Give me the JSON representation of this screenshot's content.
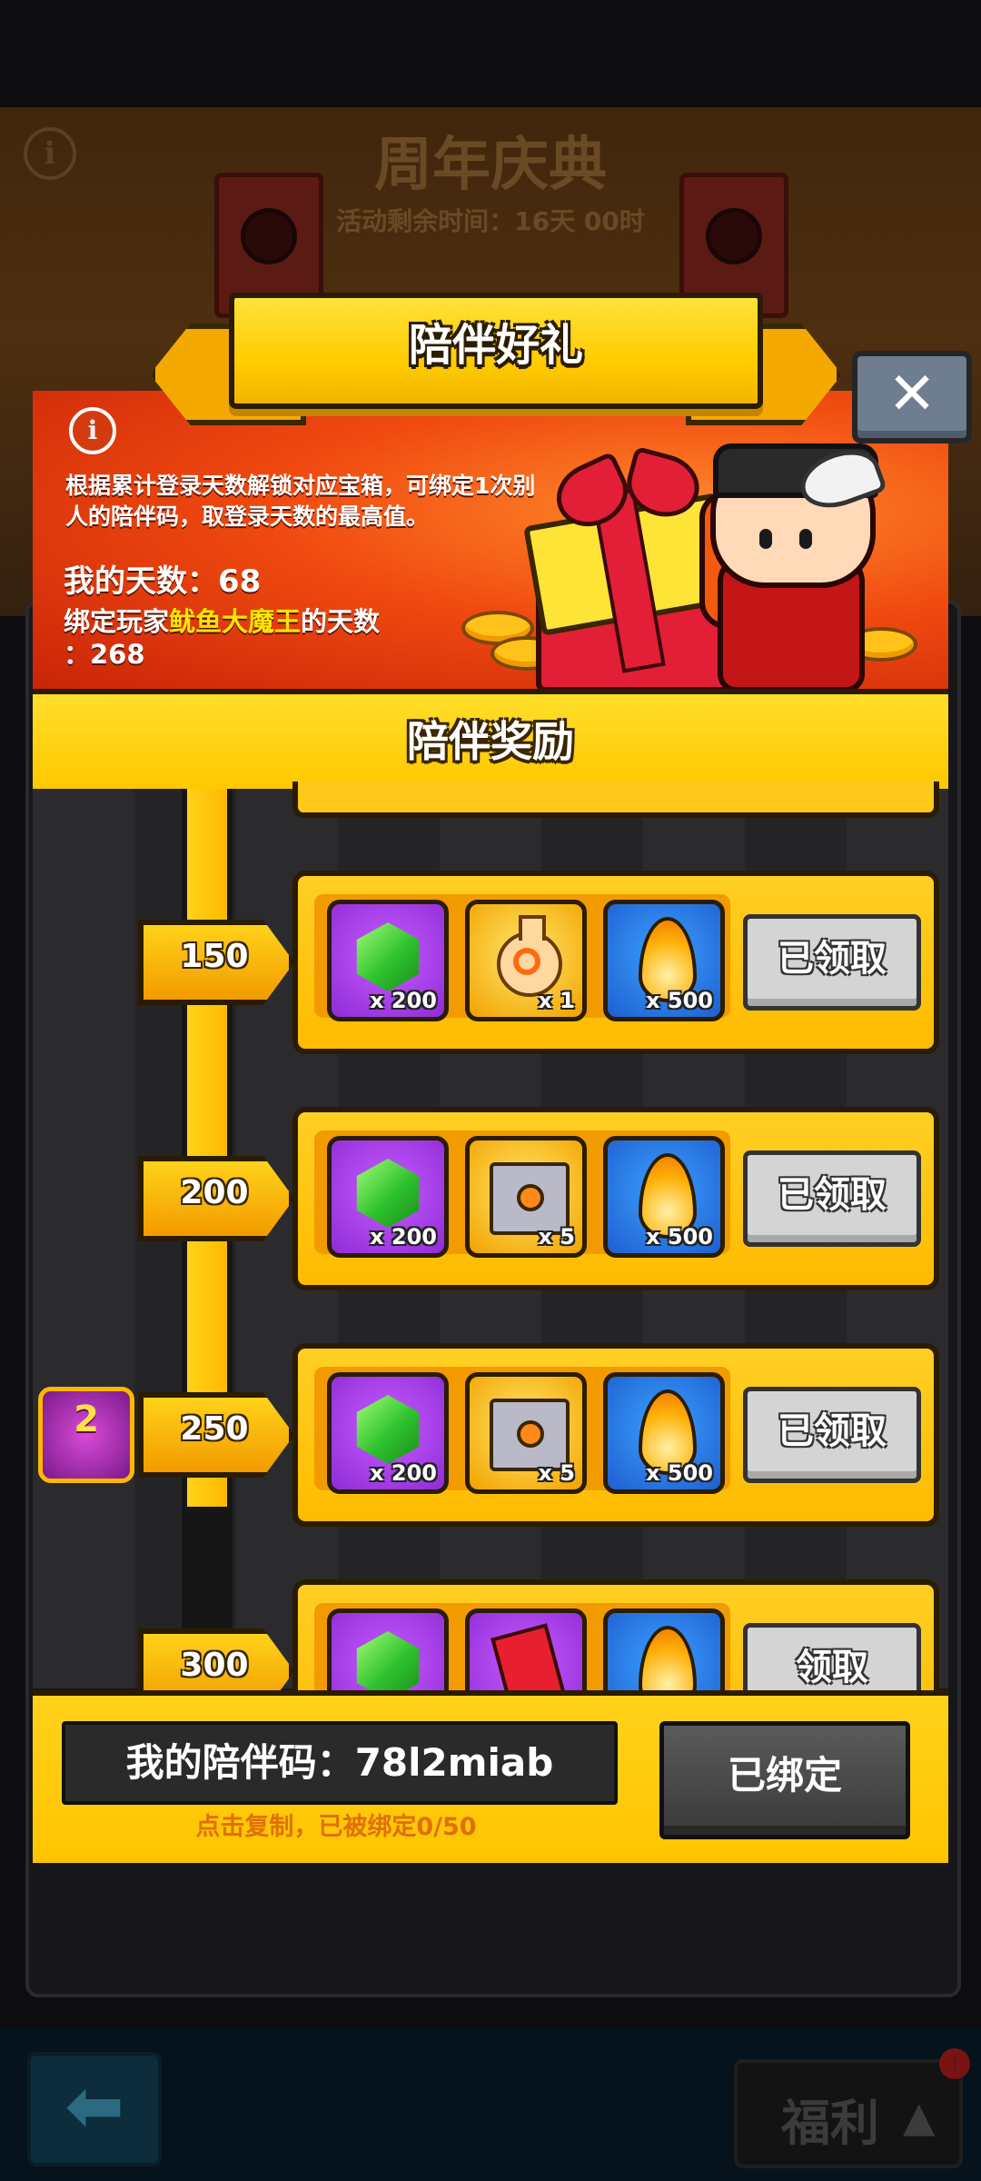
{
  "background": {
    "title": "周年庆典",
    "subtitle": "活动剩余时间：16天 00时"
  },
  "dialog": {
    "title": "陪伴好礼",
    "close_glyph": "✕",
    "info_glyph": "i",
    "description": "根据累计登录天数解锁对应宝箱，可绑定1次别人的陪伴码，取登录天数的最高值。",
    "my_days_label": "我的天数：",
    "my_days_value": "68",
    "bound_prefix": "绑定玩家",
    "bound_player_name": "鱿鱼大魔王",
    "bound_suffix": "的天数",
    "bound_days": "：268",
    "section_title": "陪伴奖励"
  },
  "tiers": [
    {
      "day": "150",
      "items": [
        {
          "icon": "green-gem-icon",
          "qty": "x 200"
        },
        {
          "icon": "potion-icon",
          "qty": "x 1"
        },
        {
          "icon": "flame-icon",
          "qty": "x 500"
        }
      ],
      "button": "已领取",
      "claimed": true
    },
    {
      "day": "200",
      "items": [
        {
          "icon": "green-gem-icon",
          "qty": "x 200"
        },
        {
          "icon": "chest-icon",
          "qty": "x 5"
        },
        {
          "icon": "flame-icon",
          "qty": "x 500"
        }
      ],
      "button": "已领取",
      "claimed": true
    },
    {
      "day": "250",
      "items": [
        {
          "icon": "green-gem-icon",
          "qty": "x 200"
        },
        {
          "icon": "chest-icon",
          "qty": "x 5"
        },
        {
          "icon": "flame-icon",
          "qty": "x 500"
        }
      ],
      "button": "已领取",
      "claimed": true
    },
    {
      "day": "300",
      "items": [
        {
          "icon": "green-gem-icon",
          "qty": ""
        },
        {
          "icon": "red-envelope-icon",
          "qty": ""
        },
        {
          "icon": "flame-icon",
          "qty": ""
        }
      ],
      "button": "领取",
      "claimed": false
    }
  ],
  "badge": {
    "icon": "anniversary-cake-icon",
    "number": "2"
  },
  "footer": {
    "code_label": "我的陪伴码：",
    "code_value": "78l2miab",
    "copy_hint": "点击复制，已被绑定0/50",
    "bound_button": "已绑定"
  },
  "bottom_nav": {
    "back_glyph": "⬅",
    "welfare_label": "福利",
    "welfare_glyph": "▲",
    "alert_glyph": "!"
  },
  "colors": {
    "accent_yellow": "#ffc800",
    "header_red": "#f04a10",
    "outline": "#2b1c00",
    "claimed_gray": "#d4d4d4",
    "highlight_name": "#ffe600"
  }
}
